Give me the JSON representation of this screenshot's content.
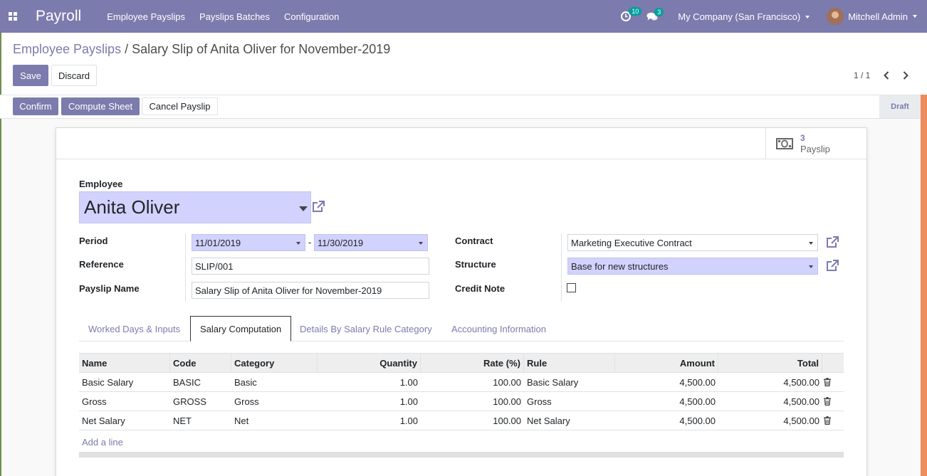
{
  "app": {
    "title": "Payroll"
  },
  "nav": {
    "menu": [
      "Employee Payslips",
      "Payslips Batches",
      "Configuration"
    ],
    "activity_count": "10",
    "message_count": "3",
    "company": "My Company (San Francisco)",
    "user": "Mitchell Admin"
  },
  "breadcrumb": {
    "parent": "Employee Payslips",
    "separator": "/",
    "current": "Salary Slip of Anita Oliver for November-2019"
  },
  "controls": {
    "save": "Save",
    "discard": "Discard"
  },
  "pager": {
    "value": "1 / 1"
  },
  "status_buttons": {
    "confirm": "Confirm",
    "compute": "Compute Sheet",
    "cancel": "Cancel Payslip"
  },
  "status": {
    "current": "Draft"
  },
  "stat_button": {
    "count": "3",
    "label": "Payslip"
  },
  "form": {
    "employee_label": "Employee",
    "employee": "Anita Oliver",
    "period_label": "Period",
    "date_from": "11/01/2019",
    "date_sep": "-",
    "date_to": "11/30/2019",
    "reference_label": "Reference",
    "reference": "SLIP/001",
    "name_label": "Payslip Name",
    "name": "Salary Slip of Anita Oliver for November-2019",
    "contract_label": "Contract",
    "contract": "Marketing Executive Contract",
    "structure_label": "Structure",
    "structure": "Base for new structures",
    "credit_note_label": "Credit Note",
    "credit_note": false
  },
  "tabs": [
    "Worked Days & Inputs",
    "Salary Computation",
    "Details By Salary Rule Category",
    "Accounting Information"
  ],
  "active_tab": "Salary Computation",
  "table": {
    "columns": [
      "Name",
      "Code",
      "Category",
      "Quantity",
      "Rate (%)",
      "Rule",
      "Amount",
      "Total"
    ],
    "rows": [
      [
        "Basic Salary",
        "BASIC",
        "Basic",
        "1.00",
        "100.00",
        "Basic Salary",
        "4,500.00",
        "4,500.00"
      ],
      [
        "Gross",
        "GROSS",
        "Gross",
        "1.00",
        "100.00",
        "Gross",
        "4,500.00",
        "4,500.00"
      ],
      [
        "Net Salary",
        "NET",
        "Net",
        "1.00",
        "100.00",
        "Net Salary",
        "4,500.00",
        "4,500.00"
      ]
    ],
    "add_line": "Add a line"
  },
  "colors": {
    "brand": "#7c7bad",
    "required": "#d2d2ff",
    "status_accent": "#ef8c5b"
  }
}
